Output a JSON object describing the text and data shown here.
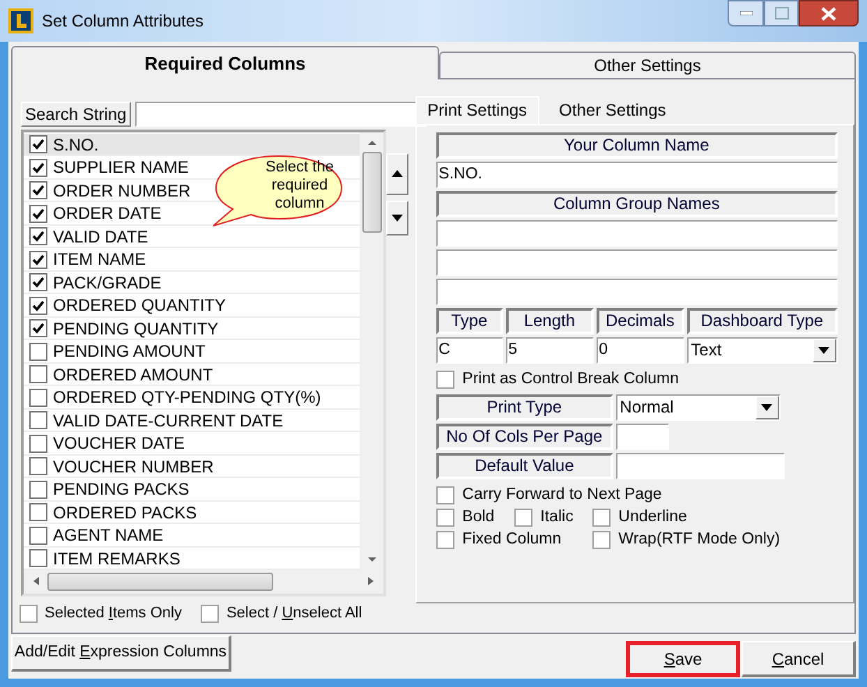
{
  "window": {
    "title": "Set Column Attributes"
  },
  "tabs": [
    {
      "label": "Required Columns",
      "selected": true
    },
    {
      "label": "Other Settings",
      "selected": false
    }
  ],
  "search": {
    "label": "Search String"
  },
  "columns": [
    {
      "label": "S.NO.",
      "checked": true,
      "selected": true
    },
    {
      "label": "SUPPLIER NAME",
      "checked": true,
      "selected": false
    },
    {
      "label": "ORDER NUMBER",
      "checked": true,
      "selected": false
    },
    {
      "label": "ORDER DATE",
      "checked": true,
      "selected": false
    },
    {
      "label": "VALID DATE",
      "checked": true,
      "selected": false
    },
    {
      "label": "ITEM NAME",
      "checked": true,
      "selected": false
    },
    {
      "label": "PACK/GRADE",
      "checked": true,
      "selected": false
    },
    {
      "label": "ORDERED QUANTITY",
      "checked": true,
      "selected": false
    },
    {
      "label": "PENDING QUANTITY",
      "checked": true,
      "selected": false
    },
    {
      "label": "PENDING AMOUNT",
      "checked": false,
      "selected": false
    },
    {
      "label": "ORDERED AMOUNT",
      "checked": false,
      "selected": false
    },
    {
      "label": "ORDERED QTY-PENDING QTY(%)",
      "checked": false,
      "selected": false
    },
    {
      "label": "VALID DATE-CURRENT DATE",
      "checked": false,
      "selected": false
    },
    {
      "label": "VOUCHER DATE",
      "checked": false,
      "selected": false
    },
    {
      "label": "VOUCHER NUMBER",
      "checked": false,
      "selected": false
    },
    {
      "label": "PENDING PACKS",
      "checked": false,
      "selected": false
    },
    {
      "label": "ORDERED PACKS",
      "checked": false,
      "selected": false
    },
    {
      "label": "AGENT NAME",
      "checked": false,
      "selected": false
    },
    {
      "label": "ITEM REMARKS",
      "checked": false,
      "selected": false
    }
  ],
  "callout": {
    "lines": [
      "Select the",
      "required",
      "column"
    ]
  },
  "list_options": [
    {
      "before": "Selected ",
      "key": "I",
      "after": "tems Only",
      "checked": false
    },
    {
      "before": "Select / ",
      "key": "U",
      "after": "nselect All",
      "checked": false
    }
  ],
  "settings_tabs": [
    {
      "label": "Print Settings",
      "selected": true
    },
    {
      "label": "Other Settings",
      "selected": false
    }
  ],
  "print_settings": {
    "column_name_header": "Your Column Name",
    "column_name": "S.NO.",
    "group_header": "Column Group Names",
    "field_headers": [
      "Type",
      "Length",
      "Decimals",
      "Dashboard Type"
    ],
    "field_values": [
      {
        "kind": "text",
        "value": "C"
      },
      {
        "kind": "text",
        "value": "5"
      },
      {
        "kind": "text",
        "value": "0"
      },
      {
        "kind": "dropdown",
        "value": "Text"
      }
    ],
    "control_break": {
      "label": "Print as Control Break Column",
      "checked": false
    },
    "labeled_fields": [
      {
        "label": "Print Type",
        "kind": "dropdown",
        "value": "Normal"
      },
      {
        "label": "No Of Cols Per Page",
        "kind": "short"
      },
      {
        "label": "Default Value",
        "kind": "text"
      }
    ],
    "options": [
      [
        {
          "label": "Carry Forward to Next Page",
          "checked": false
        }
      ],
      [
        {
          "label": "Bold",
          "checked": false
        },
        {
          "label": "Italic",
          "checked": false
        },
        {
          "label": "Underline",
          "checked": false
        }
      ],
      [
        {
          "label": "Fixed Column",
          "checked": false
        },
        {
          "label": "Wrap(RTF Mode Only)",
          "checked": false
        }
      ]
    ]
  },
  "buttons": {
    "expression": {
      "before": "Add/Edit ",
      "key": "E",
      "after": "xpression Columns"
    },
    "save": {
      "key": "S",
      "after": "ave",
      "highlighted": true
    },
    "cancel": {
      "key": "C",
      "after": "ancel",
      "highlighted": false
    }
  }
}
